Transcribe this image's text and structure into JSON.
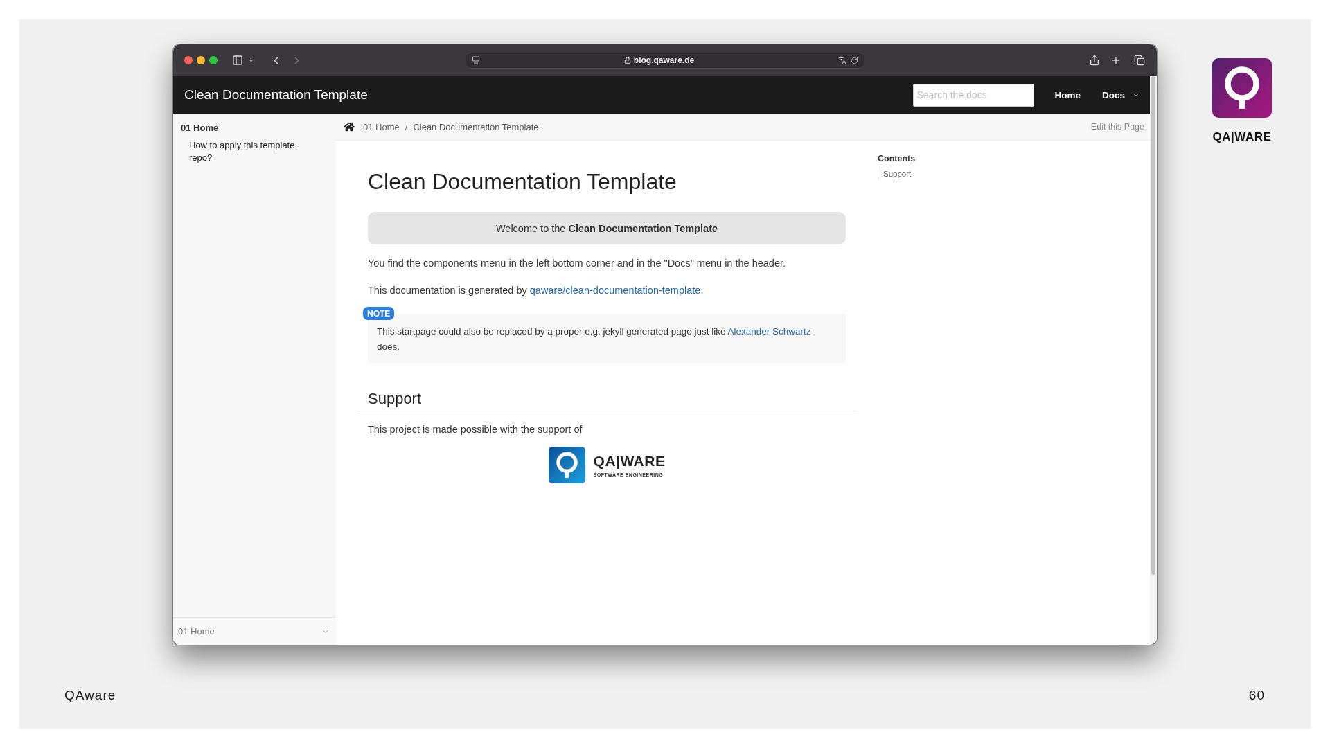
{
  "browser": {
    "url": "blog.qaware.de",
    "nav_buttons": [
      {
        "kind": "back",
        "disabled": false
      },
      {
        "kind": "forward",
        "disabled": true
      }
    ]
  },
  "site_header": {
    "title": "Clean Documentation Template",
    "search": {
      "placeholder": "Search the docs"
    },
    "nav": [
      {
        "kind": "link",
        "label": "Home"
      },
      {
        "kind": "dropdown",
        "label": "Docs"
      }
    ]
  },
  "sidebar": {
    "items": [
      {
        "label": "01 Home",
        "children": [
          {
            "label": "How to apply this template repo?"
          }
        ]
      }
    ],
    "footer_select": {
      "value": "01 Home"
    }
  },
  "breadcrumb": {
    "items": [
      "01 Home",
      "Clean Documentation Template"
    ],
    "separator": "/",
    "edit_link": "Edit this Page"
  },
  "article": {
    "title": "Clean Documentation Template",
    "blocks": [
      {
        "kind": "banner",
        "text": "Welcome to the **Clean Documentation Template**"
      },
      {
        "kind": "paragraph",
        "parts": [
          {
            "kind": "text",
            "text": "You find the components menu in the left bottom corner and in the \"Docs\" menu in the header."
          }
        ]
      },
      {
        "kind": "paragraph",
        "parts": [
          {
            "kind": "text",
            "text": "This documentation is generated by "
          },
          {
            "kind": "link",
            "text": "qaware/clean-documentation-template"
          },
          {
            "kind": "text",
            "text": "."
          }
        ]
      },
      {
        "kind": "note",
        "label": "NOTE",
        "parts": [
          {
            "kind": "text",
            "text": "This startpage could also be replaced by a proper e.g. jekyll generated page just like "
          },
          {
            "kind": "link",
            "text": "Alexander Schwartz"
          },
          {
            "kind": "text",
            "text": " does."
          }
        ]
      },
      {
        "kind": "heading",
        "text": "Support"
      },
      {
        "kind": "paragraph",
        "parts": [
          {
            "kind": "text",
            "text": "This project is made possible with the support of"
          }
        ]
      },
      {
        "kind": "logo",
        "name": "QA|WARE",
        "tagline": "SOFTWARE ENGINEERING"
      }
    ]
  },
  "toc": {
    "title": "Contents",
    "items": [
      "Support"
    ]
  },
  "slide": {
    "brand_logo": {
      "name": "QA|WARE"
    },
    "footer_left": "QAware",
    "page_number": "60"
  }
}
